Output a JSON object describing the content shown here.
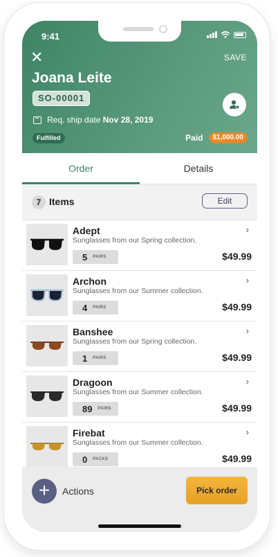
{
  "status": {
    "time": "9:41"
  },
  "header": {
    "save_label": "SAVE",
    "customer_name": "Joana Leite",
    "order_id": "SO-00001",
    "ship_label": "Req. ship date",
    "ship_date": "Nov 28, 2019",
    "fulfillment_status": "Fulfilled",
    "payment_label": "Paid",
    "payment_amount": "$1,000.00",
    "colors": {
      "header_bg": "#4a8c6f",
      "paid_badge": "#e28a2d"
    }
  },
  "tabs": [
    {
      "label": "Order",
      "active": true
    },
    {
      "label": "Details",
      "active": false
    }
  ],
  "items_header": {
    "count": "7",
    "label": "Items",
    "edit_label": "Edit"
  },
  "items": [
    {
      "name": "Adept",
      "description": "Sunglasses from our Spring collection.",
      "qty": "5",
      "unit": "PAIRS",
      "price": "$49.99",
      "icon": "sunglasses-icon"
    },
    {
      "name": "Archon",
      "description": "Sunglasses from our Summer collection.",
      "qty": "4",
      "unit": "PAIRS",
      "price": "$49.99",
      "icon": "sunglasses-icon"
    },
    {
      "name": "Banshee",
      "description": "Sunglasses from our Spring collection.",
      "qty": "1",
      "unit": "PAIRS",
      "price": "$49.99",
      "icon": "sunglasses-icon"
    },
    {
      "name": "Dragoon",
      "description": "Sunglasses from our Summer collection.",
      "qty": "89",
      "unit": "PAIRS",
      "price": "$49.99",
      "icon": "sunglasses-icon"
    },
    {
      "name": "Firebat",
      "description": "Sunglasses from our Summer collection.",
      "qty": "0",
      "unit": "PACKS",
      "price": "$49.99",
      "icon": "sunglasses-icon"
    }
  ],
  "footer": {
    "actions_label": "Actions",
    "pick_label": "Pick order",
    "colors": {
      "pick_button": "#f0b032"
    }
  }
}
